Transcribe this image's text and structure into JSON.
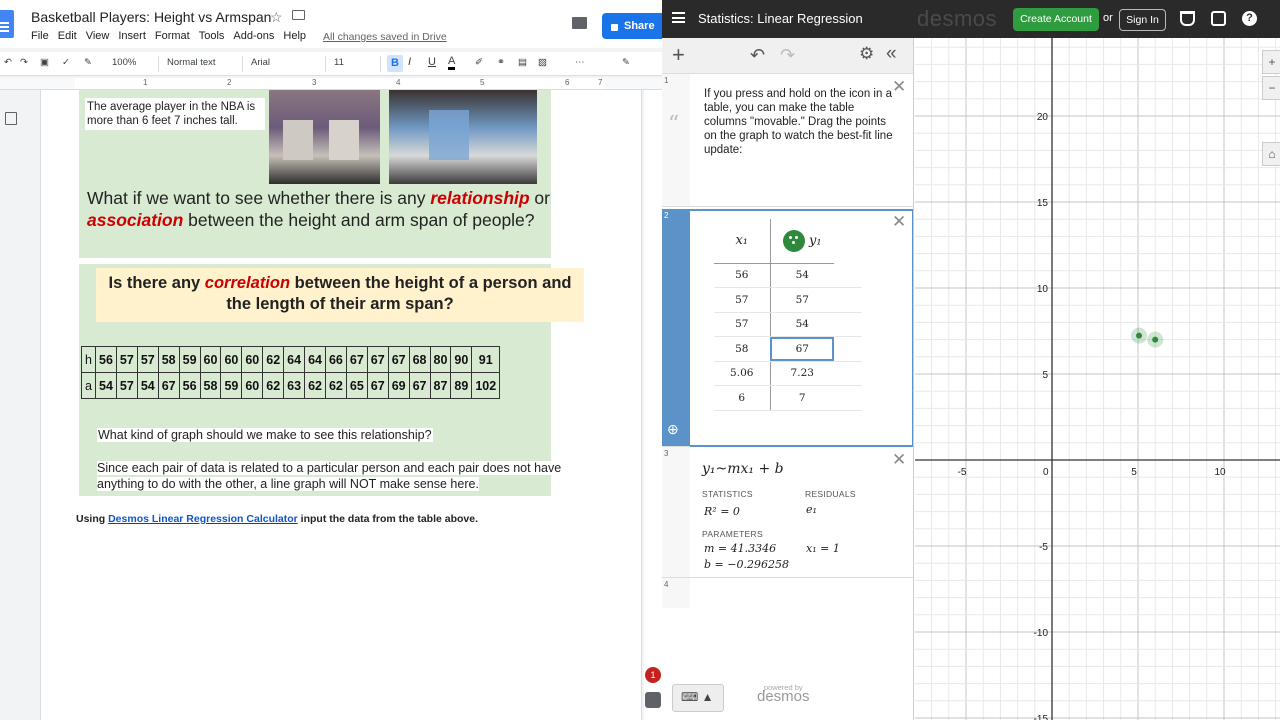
{
  "docs": {
    "title": "Basketball Players: Height vs Armspan",
    "star_glyph": "☆",
    "menu": [
      "File",
      "Edit",
      "View",
      "Insert",
      "Format",
      "Tools",
      "Add-ons",
      "Help"
    ],
    "saved_status": "All changes saved in Drive",
    "share_label": "Share",
    "toolbar": {
      "zoom": "100%",
      "style": "Normal text",
      "font": "Arial",
      "size": "11",
      "bold": "B",
      "italic": "I",
      "underline": "U",
      "color": "A"
    },
    "ruler_numbers": [
      "1",
      "2",
      "3",
      "4",
      "5",
      "6",
      "7"
    ],
    "caption": "The average player in the NBA is more than 6 feet 7 inches tall.",
    "question": {
      "p1": "What if we want to see whether there is any ",
      "w1": "relationship",
      "p2": " or ",
      "w2": "association",
      "p3": " between the height and arm span of people?"
    },
    "correlation_q": {
      "p1": "Is there any ",
      "w1": "correlation",
      "p2": " between the height of a person and the length of their arm span?"
    },
    "table": {
      "h_label": "h",
      "a_label": "a",
      "h": [
        "56",
        "57",
        "57",
        "58",
        "59",
        "60",
        "60",
        "60",
        "62",
        "64",
        "64",
        "66",
        "67",
        "67",
        "67",
        "68",
        "80",
        "90",
        "91"
      ],
      "a": [
        "54",
        "57",
        "54",
        "67",
        "56",
        "58",
        "59",
        "60",
        "62",
        "63",
        "62",
        "62",
        "65",
        "67",
        "69",
        "67",
        "87",
        "89",
        "102"
      ]
    },
    "graph_question": "What kind of graph should we make to see this relationship?",
    "line_graph_note": "Since each pair of data is related to a particular person and each pair does not have anything to do with the other, a line graph will NOT make sense here.",
    "using": {
      "p1": "Using ",
      "link": "Desmos Linear Regression Calculator",
      "p2": " input the data from the table above."
    },
    "notification_count": "1"
  },
  "desmos": {
    "title": "Statistics: Linear Regression",
    "logo": "desmos",
    "create_account": "Create Account",
    "or": "or",
    "sign_in": "Sign In",
    "help": "?",
    "list_toolbar": {
      "add": "+",
      "undo": "↶",
      "redo": "↷",
      "settings": "⚙",
      "collapse": "«"
    },
    "close_glyph": "✕",
    "expr1": {
      "num": "1",
      "note": "If you press and hold on the icon in a table, you can make the table columns \"movable.\" Drag the points on the graph to watch the best-fit line update:"
    },
    "expr2": {
      "num": "2",
      "col_x": "x₁",
      "col_y": "y₁",
      "rows": [
        [
          "56",
          "54"
        ],
        [
          "57",
          "57"
        ],
        [
          "57",
          "54"
        ],
        [
          "58",
          "67"
        ],
        [
          "5.06",
          "7.23"
        ],
        [
          "6",
          "7"
        ]
      ]
    },
    "expr3": {
      "num": "3",
      "formula": "y₁~mx₁ + b",
      "statistics_label": "STATISTICS",
      "residuals_label": "RESIDUALS",
      "r2": "R² = 0",
      "residual": "e₁",
      "parameters_label": "PARAMETERS",
      "m": "m = 41.3346",
      "b": "b = −0.296258",
      "x1": "x₁ = 1"
    },
    "expr4": {
      "num": "4"
    },
    "keyboard": "⌨ ▲",
    "powered_by": "powered by",
    "powered_logo": "desmos",
    "graph_tools": {
      "zoom_in": "+",
      "zoom_out": "−",
      "home": "⌂"
    },
    "graph": {
      "x_ticks": [
        -5,
        0,
        5,
        10
      ],
      "y_ticks": [
        20,
        15,
        10,
        5,
        -5,
        -10,
        -15
      ],
      "points": [
        [
          5.06,
          7.23
        ],
        [
          6,
          7
        ]
      ],
      "point_color": "#2d8a3c"
    }
  },
  "colors": {
    "accent_blue": "#1a73e8",
    "desmos_green": "#2f9c3f",
    "emph_red": "#cc0000",
    "green_box": "#d9ead3",
    "yellow_box": "#fff2cc"
  }
}
